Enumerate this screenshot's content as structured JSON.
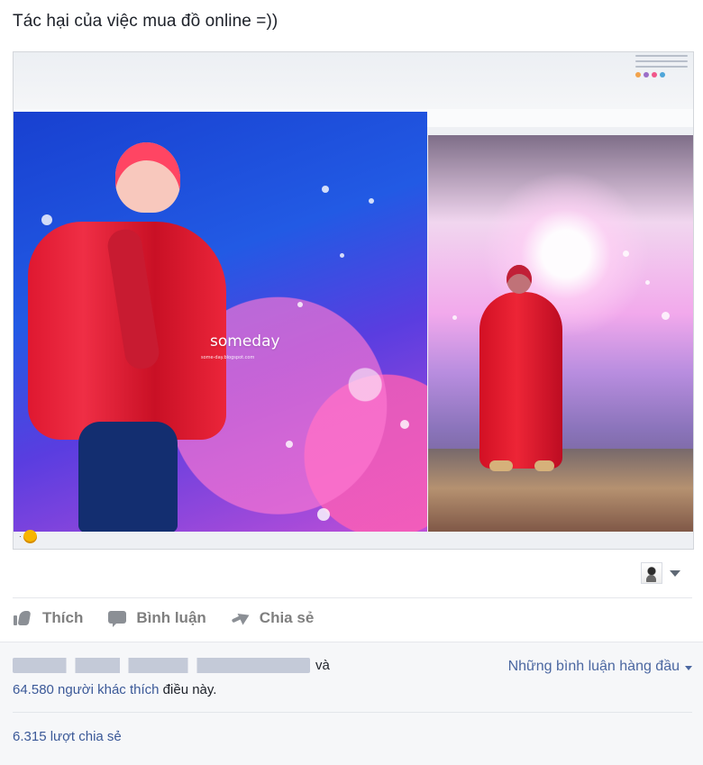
{
  "post": {
    "title": "Tác hại của việc mua đồ online =))"
  },
  "media": {
    "watermark": "someday",
    "watermark_small": "some-day.blogspot.com"
  },
  "actions": {
    "like_label": "Thích",
    "comment_label": "Bình luận",
    "share_label": "Chia sẻ"
  },
  "feedback": {
    "and_text": "và",
    "others_count_text": "64.580 người khác",
    "like_text": "thích",
    "rest_text": "điều này.",
    "top_comments_label": "Những bình luận hàng đầu",
    "shares_text": "6.315 lượt chia sẻ"
  },
  "icons": {
    "like": "thumbs-up-icon",
    "comment": "comment-icon",
    "share": "share-arrow-icon",
    "caret": "chevron-down-icon"
  },
  "colors": {
    "link": "#3b5998",
    "action_text": "#7f7f7f",
    "feedback_background": "#f6f7f9"
  }
}
